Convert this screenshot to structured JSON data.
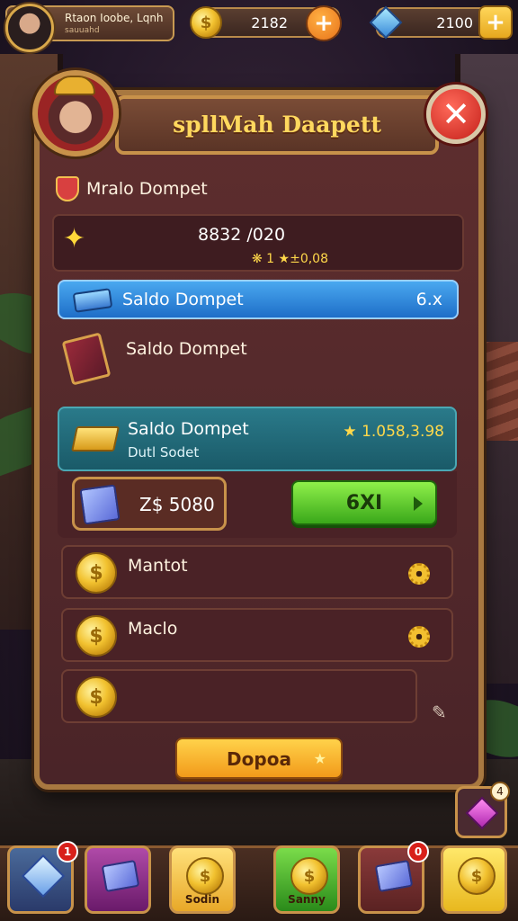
{
  "player": {
    "name": "Rtaon Ioobe, Lqnh",
    "subtitle": "sauuahd"
  },
  "resources": {
    "coins": {
      "value": "2182",
      "icon": "coin-icon",
      "add_icon": "plus-icon"
    },
    "gems": {
      "value": "2100",
      "icon": "gem-icon",
      "add_icon": "plus-icon"
    }
  },
  "panel": {
    "title": "spllMah Daapett",
    "close_icon": "close-icon",
    "section_title": "Mralo Dompet",
    "balance": {
      "main": "8832 /020",
      "sub": "❋ 1 ★±0,08"
    },
    "blue_row": {
      "label": "Saldo Dompet",
      "value": "6.x"
    },
    "plain_row": {
      "label": "Saldo Dompet"
    },
    "teal_row": {
      "label": "Saldo Dompet",
      "sub": "Dutl Sodet",
      "value": "★ 1.058,3.98"
    },
    "trade": {
      "value": "Z$ 5080",
      "button_label": "6XI"
    },
    "list": [
      {
        "label": "Mantot"
      },
      {
        "label": "Maclo"
      },
      {
        "label": ""
      }
    ],
    "action_button": "Dopoa"
  },
  "side_button": {
    "badge": "4"
  },
  "bottom_nav": [
    {
      "label": "",
      "badge": "1",
      "icon": "crystal-icon"
    },
    {
      "label": "",
      "badge": "",
      "icon": "box-icon"
    },
    {
      "label": "Sodin",
      "badge": "",
      "icon": "coin-icon"
    },
    {
      "label": "Sanny",
      "badge": "",
      "icon": "coin-icon"
    },
    {
      "label": "",
      "badge": "0",
      "icon": "box-icon"
    },
    {
      "label": "",
      "badge": "",
      "icon": "coin-icon"
    }
  ],
  "colors": {
    "panel": "#5e2e2e",
    "frame": "#a87840",
    "title_text": "#ffd85e",
    "blue_row": "#1e6ec8",
    "teal_row": "#2a7a8a",
    "green_button": "#3aa81a",
    "orange_button": "#f29a1a",
    "close_button": "#c4201a"
  }
}
